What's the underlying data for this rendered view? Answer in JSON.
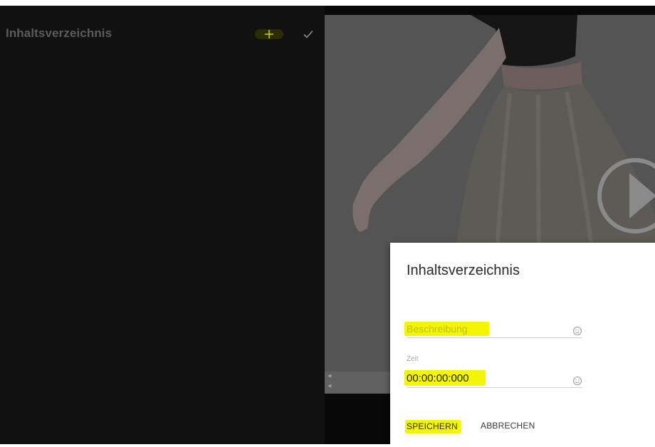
{
  "sidebar": {
    "title": "Inhaltsverzeichnis",
    "add_icon": "plus-icon",
    "confirm_icon": "check-icon"
  },
  "video": {
    "play_icon": "play-icon"
  },
  "dialog": {
    "title": "Inhaltsverzeichnis",
    "description": {
      "placeholder": "Beschreibung",
      "value": "",
      "icon": "smiley-icon"
    },
    "time": {
      "label": "Zeit",
      "value": "00:00:00:000",
      "icon": "smiley-icon"
    },
    "save_label": "SPEICHERN",
    "cancel_label": "ABBRECHEN"
  },
  "colors": {
    "highlight": "#f4f500",
    "sidebar_bg": "#111111",
    "accent_plus": "#c7c700"
  }
}
